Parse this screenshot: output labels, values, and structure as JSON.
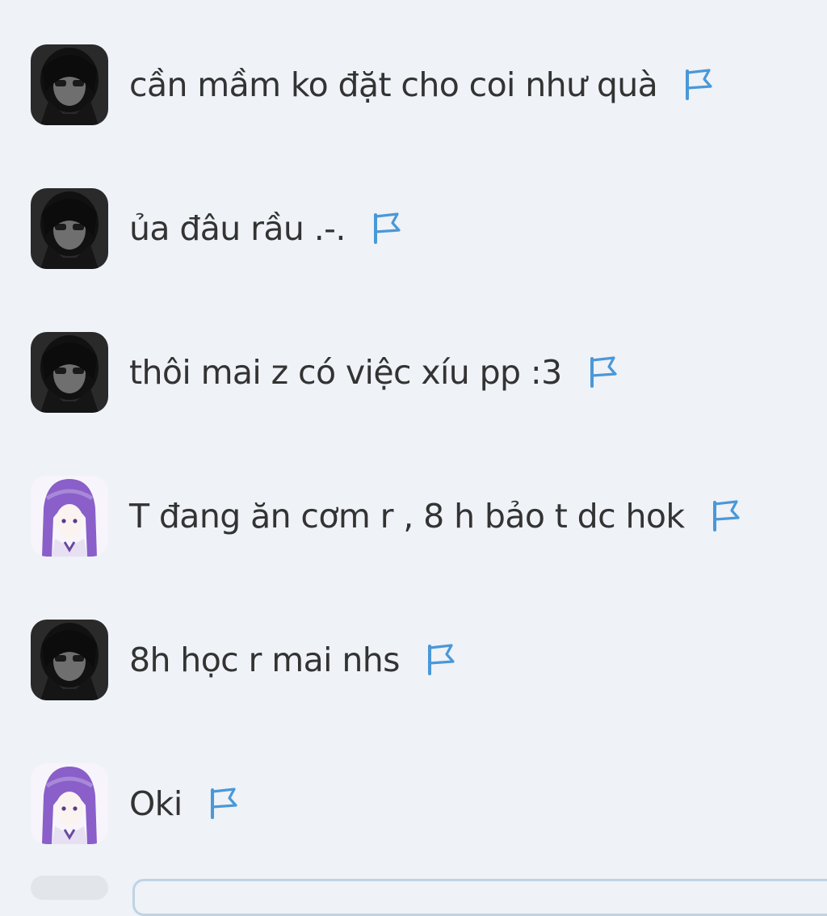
{
  "messages": [
    {
      "text": "cần mầm ko đặt cho coi như quà",
      "avatar": "dark-avatar"
    },
    {
      "text": "ủa đâu rầu .-.",
      "avatar": "dark-avatar"
    },
    {
      "text": "thôi mai z có việc xíu pp :3",
      "avatar": "dark-avatar"
    },
    {
      "text": "T đang ăn cơm r , 8 h bảo t dc hok",
      "avatar": "anime-avatar"
    },
    {
      "text": "8h học r mai nhs",
      "avatar": "dark-avatar"
    },
    {
      "text": "Oki",
      "avatar": "anime-avatar"
    }
  ],
  "icons": {
    "report": "flag-icon"
  },
  "colors": {
    "background": "#eff2f7",
    "text": "#333333",
    "flag": "#4a98d8"
  }
}
